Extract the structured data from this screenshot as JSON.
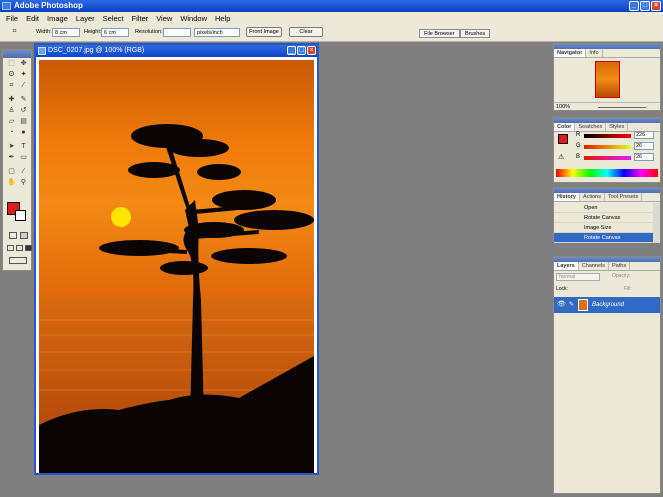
{
  "app": {
    "title": "Adobe Photoshop"
  },
  "menu": [
    "File",
    "Edit",
    "Image",
    "Layer",
    "Select",
    "Filter",
    "View",
    "Window",
    "Help"
  ],
  "options": {
    "width_label": "Width:",
    "width_value": "8 cm",
    "height_label": "Height:",
    "height_value": "6 cm",
    "resolution_label": "Resolution:",
    "resolution_value": "",
    "units_value": "pixels/inch",
    "front_image": "Front Image",
    "clear": "Clear",
    "file_browser_tab": "File Browser",
    "brushes_tab": "Brushes"
  },
  "document": {
    "title": "DSC_0207.jpg @ 100% (RGB)"
  },
  "navigator": {
    "tabs": [
      "Navigator",
      "Info"
    ],
    "zoom": "100%"
  },
  "color": {
    "tabs": [
      "Color",
      "Swatches",
      "Styles"
    ],
    "channels": [
      {
        "label": "R",
        "value": "226",
        "color": "#e21a1a"
      },
      {
        "label": "G",
        "value": "26",
        "color": "#22aa22"
      },
      {
        "label": "B",
        "value": "26",
        "color": "#2244dd"
      }
    ],
    "foreground": "#e21a1a"
  },
  "history": {
    "tabs": [
      "History",
      "Actions",
      "Tool Presets"
    ],
    "items": [
      "Open",
      "Rotate Canvas",
      "Image Size",
      "Rotate Canvas"
    ]
  },
  "layers": {
    "tabs": [
      "Layers",
      "Channels",
      "Paths"
    ],
    "blend_mode": "Normal",
    "opacity_label": "Opacity:",
    "lock_label": "Lock:",
    "fill_label": "Fill:",
    "layer_name": "Background"
  }
}
